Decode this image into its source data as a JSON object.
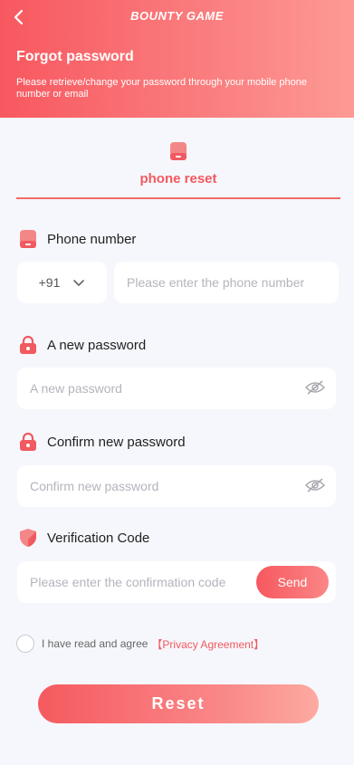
{
  "header": {
    "back_icon": "chevron-left-icon",
    "logo": "BOUNTY GAME",
    "title": "Forgot password",
    "subtitle": "Please retrieve/change your password through your mobile phone number or email"
  },
  "tab": {
    "icon": "phone-icon",
    "label": "phone reset"
  },
  "phone": {
    "label": "Phone number",
    "icon": "phone-icon",
    "country_code": "+91",
    "placeholder": "Please enter the phone number"
  },
  "new_password": {
    "label": "A new password",
    "icon": "lock-icon",
    "placeholder": "A new password"
  },
  "confirm_password": {
    "label": "Confirm new password",
    "icon": "lock-icon",
    "placeholder": "Confirm new password"
  },
  "verification": {
    "label": "Verification Code",
    "icon": "shield-icon",
    "placeholder": "Please enter the confirmation code",
    "send_label": "Send"
  },
  "agreement": {
    "text": "I have read and agree",
    "link": "【Privacy Agreement】"
  },
  "reset_label": "Reset",
  "colors": {
    "accent": "#f2595f",
    "background": "#f6f7fc"
  }
}
